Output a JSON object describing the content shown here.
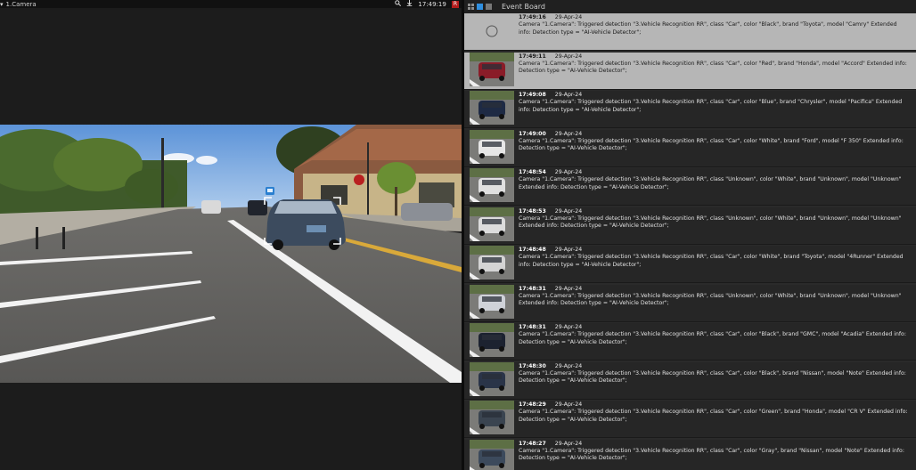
{
  "camera": {
    "title": "1.Camera",
    "time": "17:49:19",
    "rec_label": "R",
    "icons": [
      "filter-icon",
      "search-icon",
      "download-icon"
    ]
  },
  "event_board": {
    "title": "Event Board",
    "icons": [
      "grid-view-icon",
      "list-view-icon",
      "single-view-icon"
    ],
    "events": [
      {
        "time": "17:49:16",
        "date": "29-Apr-24",
        "text": "Camera \"1.Camera\": Triggered detection \"3.Vehicle Recognition RR\", class \"Car\", color \"Black\", brand \"Toyota\", model \"Camry\" Extended info: Detection type = \"AI-Vehicle Detector\";",
        "car_color": "",
        "selected": true,
        "loading": true
      },
      {
        "time": "17:49:11",
        "date": "29-Apr-24",
        "text": "Camera \"1.Camera\": Triggered detection \"3.Vehicle Recognition RR\", class \"Car\", color \"Red\", brand \"Honda\", model \"Accord\" Extended info: Detection type = \"AI-Vehicle Detector\";",
        "car_color": "#8a1c28",
        "selected": true,
        "loading": false
      },
      {
        "time": "17:49:08",
        "date": "29-Apr-24",
        "text": "Camera \"1.Camera\": Triggered detection \"3.Vehicle Recognition RR\", class \"Car\", color \"Blue\", brand \"Chrysler\", model \"Pacifica\" Extended info: Detection type = \"AI-Vehicle Detector\";",
        "car_color": "#1e2a44",
        "selected": false,
        "loading": false
      },
      {
        "time": "17:49:00",
        "date": "29-Apr-24",
        "text": "Camera \"1.Camera\": Triggered detection \"3.Vehicle Recognition RR\", class \"Car\", color \"White\", brand \"Ford\", model \"F 350\" Extended info: Detection type = \"AI-Vehicle Detector\";",
        "car_color": "#e6e6e6",
        "selected": false,
        "loading": false
      },
      {
        "time": "17:48:54",
        "date": "29-Apr-24",
        "text": "Camera \"1.Camera\": Triggered detection \"3.Vehicle Recognition RR\", class \"Unknown\", color \"White\", brand \"Unknown\", model \"Unknown\" Extended info: Detection type = \"AI-Vehicle Detector\";",
        "car_color": "#e0e0e0",
        "selected": false,
        "loading": false
      },
      {
        "time": "17:48:53",
        "date": "29-Apr-24",
        "text": "Camera \"1.Camera\": Triggered detection \"3.Vehicle Recognition RR\", class \"Unknown\", color \"White\", brand \"Unknown\", model \"Unknown\" Extended info: Detection type = \"AI-Vehicle Detector\";",
        "car_color": "#dcdcdc",
        "selected": false,
        "loading": false
      },
      {
        "time": "17:48:48",
        "date": "29-Apr-24",
        "text": "Camera \"1.Camera\": Triggered detection \"3.Vehicle Recognition RR\", class \"Car\", color \"White\", brand \"Toyota\", model \"4Runner\" Extended info: Detection type = \"AI-Vehicle Detector\";",
        "car_color": "#d4d4d4",
        "selected": false,
        "loading": false
      },
      {
        "time": "17:48:31",
        "date": "29-Apr-24",
        "text": "Camera \"1.Camera\": Triggered detection \"3.Vehicle Recognition RR\", class \"Unknown\", color \"White\", brand \"Unknown\", model \"Unknown\" Extended info: Detection type = \"AI-Vehicle Detector\";",
        "car_color": "#cfd2d8",
        "selected": false,
        "loading": false
      },
      {
        "time": "17:48:31",
        "date": "29-Apr-24",
        "text": "Camera \"1.Camera\": Triggered detection \"3.Vehicle Recognition RR\", class \"Car\", color \"Black\", brand \"GMC\", model \"Acadia\" Extended info: Detection type = \"AI-Vehicle Detector\";",
        "car_color": "#1c2230",
        "selected": false,
        "loading": false
      },
      {
        "time": "17:48:30",
        "date": "29-Apr-24",
        "text": "Camera \"1.Camera\": Triggered detection \"3.Vehicle Recognition RR\", class \"Car\", color \"Black\", brand \"Nissan\", model \"Note\" Extended info: Detection type = \"AI-Vehicle Detector\";",
        "car_color": "#2a3448",
        "selected": false,
        "loading": false
      },
      {
        "time": "17:48:29",
        "date": "29-Apr-24",
        "text": "Camera \"1.Camera\": Triggered detection \"3.Vehicle Recognition RR\", class \"Car\", color \"Green\", brand \"Honda\", model \"CR V\" Extended info: Detection type = \"AI-Vehicle Detector\";",
        "car_color": "#3a4450",
        "selected": false,
        "loading": false
      },
      {
        "time": "17:48:27",
        "date": "29-Apr-24",
        "text": "Camera \"1.Camera\": Triggered detection \"3.Vehicle Recognition RR\", class \"Car\", color \"Gray\", brand \"Nissan\", model \"Note\" Extended info: Detection type = \"AI-Vehicle Detector\";",
        "car_color": "#3c4a5c",
        "selected": false,
        "loading": false
      }
    ]
  },
  "colors": {
    "accent": "#2f8fe0",
    "detection_box": "#ffffff",
    "detection_tag": "#2a7fd0",
    "rec": "#b31c1c"
  }
}
